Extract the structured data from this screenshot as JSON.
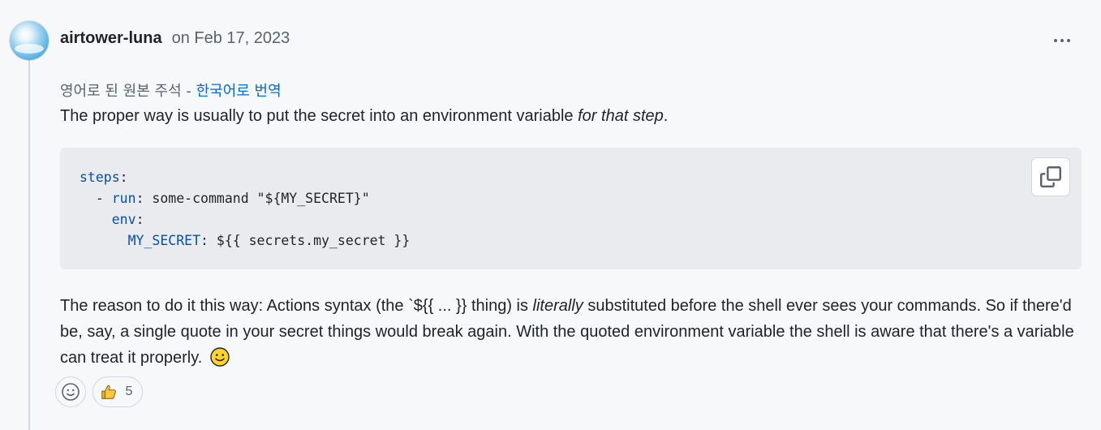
{
  "comment": {
    "author": "airtower-luna",
    "date": "on Feb 17, 2023",
    "translation_note_prefix": "영어로 된 원본 주석 - ",
    "translation_link": "한국어로 번역",
    "paragraph1": {
      "text_before": "The proper way is usually to put the secret into an environment variable ",
      "emphasis": "for that step",
      "text_after": "."
    },
    "code": {
      "lines": [
        {
          "indent": "",
          "key": "steps",
          "rest": ":"
        },
        {
          "indent": "  - ",
          "key": "run",
          "rest": ": some-command \"${MY_SECRET}\""
        },
        {
          "indent": "    ",
          "key": "env",
          "rest": ":"
        },
        {
          "indent": "      ",
          "key": "MY_SECRET",
          "rest": ": ${{ secrets.my_secret }}"
        }
      ]
    },
    "paragraph2": {
      "text_before": "The reason to do it this way: Actions syntax (the `${{ ... }} thing) is ",
      "emphasis": "literally",
      "text_after": " substituted before the shell ever sees your commands. So if there'd be, say, a single quote in your secret things would break again. With the quoted environment variable the shell is aware that there's a variable can treat it properly."
    },
    "reactions": {
      "thumbs_up_count": "5"
    }
  },
  "icons": {
    "more": "kebab-horizontal-icon",
    "copy": "copy-icon",
    "smiley": "smiley-icon",
    "thumbs_up": "thumbs-up-icon",
    "emoji": "slightly-smiling-face-icon"
  },
  "colors": {
    "link": "#0969da",
    "code_key": "#0550ae",
    "code_bg": "#e9ebef",
    "page_bg": "#f6f8fa"
  }
}
